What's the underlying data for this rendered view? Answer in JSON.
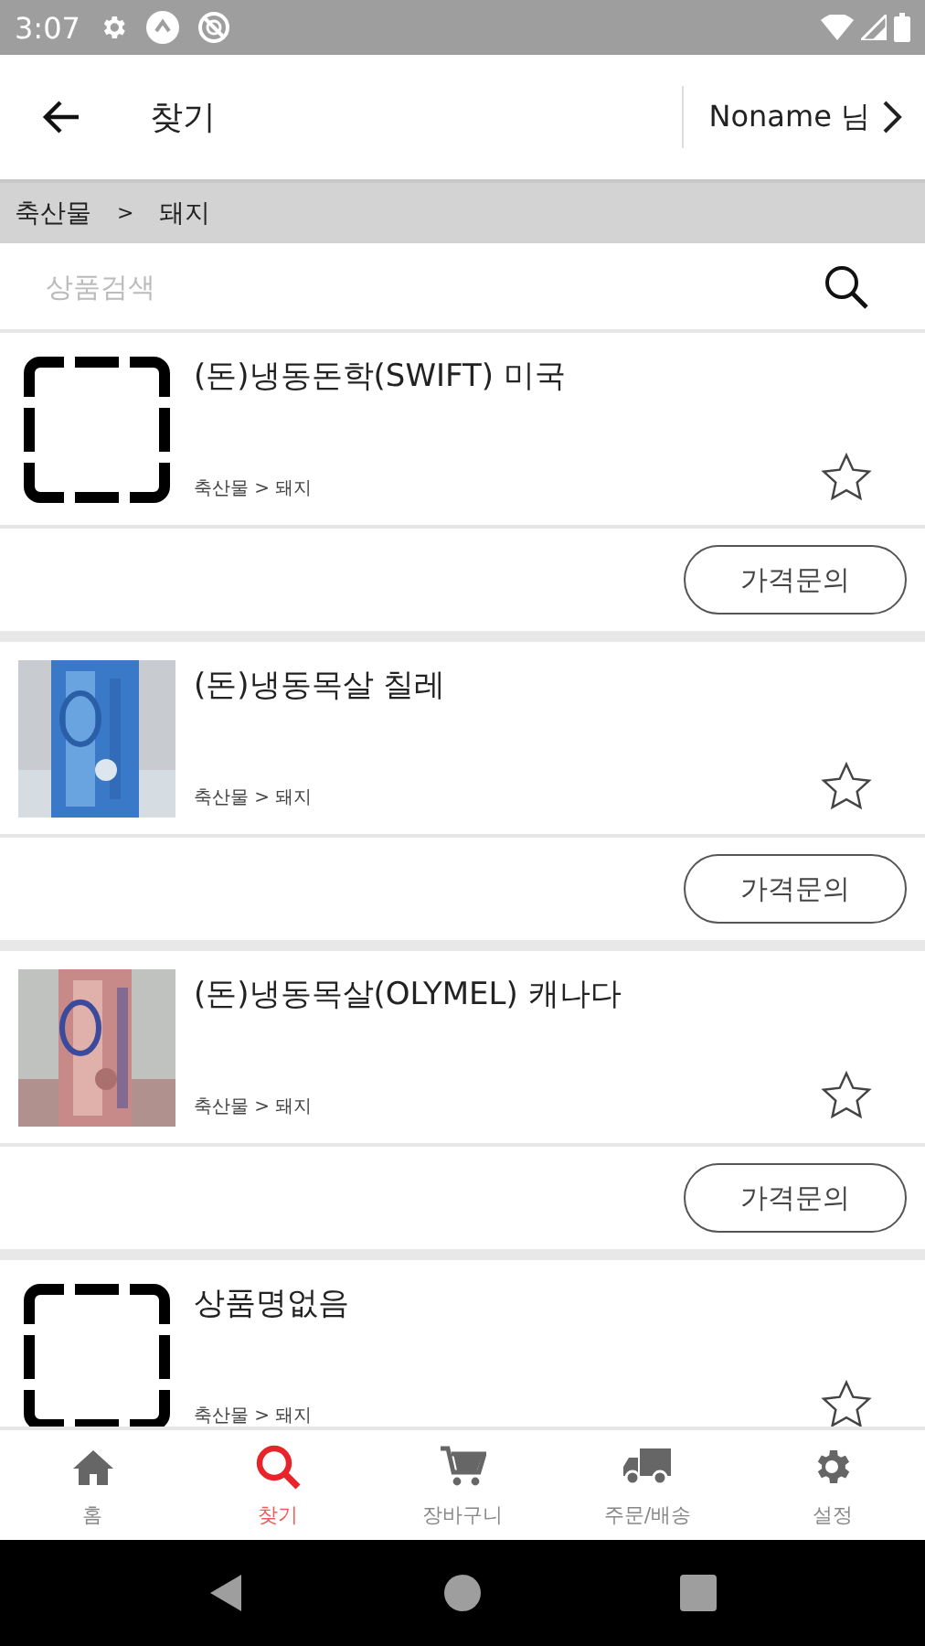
{
  "status_bar": {
    "time": "3:07"
  },
  "header": {
    "title": "찾기",
    "user": "Noname 님"
  },
  "breadcrumb": [
    "축산물",
    "돼지"
  ],
  "breadcrumb_separator": ">",
  "search": {
    "placeholder": "상품검색"
  },
  "products": [
    {
      "name": "(돈)냉동돈학(SWIFT) 미국",
      "category": "축산물 > 돼지",
      "kind": "placeholder",
      "favorite": false,
      "button": "가격문의"
    },
    {
      "name": "(돈)냉동목살 칠레",
      "category": "축산물 > 돼지",
      "kind": "picture",
      "favorite": false,
      "button": "가격문의"
    },
    {
      "name": "(돈)냉동목살(OLYMEL) 캐나다",
      "category": "축산물 > 돼지",
      "kind": "picture",
      "favorite": false,
      "button": "가격문의"
    },
    {
      "name": "상품명없음",
      "category": "축산물 > 돼지",
      "kind": "placeholder",
      "favorite": false
    }
  ],
  "bottom_nav": [
    {
      "kind": "home",
      "label": "홈",
      "selected": false
    },
    {
      "kind": "search",
      "label": "찾기",
      "selected": true
    },
    {
      "kind": "cart",
      "label": "장바구니",
      "selected": false
    },
    {
      "kind": "truck",
      "label": "주문/배송",
      "selected": false
    },
    {
      "kind": "settings",
      "label": "설정",
      "selected": false
    }
  ]
}
